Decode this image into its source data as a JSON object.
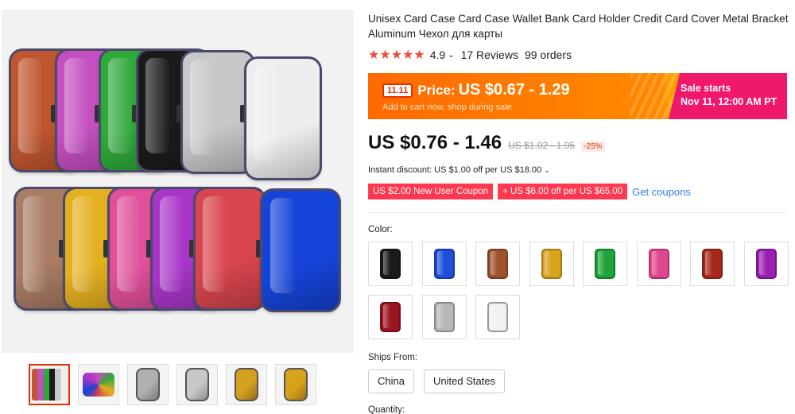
{
  "product": {
    "title": "Unisex Card Case Card Case Wallet Bank Card Holder Credit Card Cover Metal Bracket Aluminum Чехол для карты",
    "rating": "4.9",
    "reviews": "17 Reviews",
    "orders": "99 orders"
  },
  "promo": {
    "badge": "11.11",
    "price_label": "Price:",
    "price": "US $0.67 - 1.29",
    "subtitle": "Add to cart now, shop during sale",
    "sale_starts_label": "Sale starts",
    "sale_starts_date": "Nov 11, 12:00 AM PT"
  },
  "price": {
    "current": "US $0.76 - 1.46",
    "original": "US $1.02 - 1.95",
    "discount": "-25%"
  },
  "instant_discount": "Instant discount: US $1.00 off per US $18.00",
  "coupons": {
    "new_user": "US $2.00 New User Coupon",
    "store": "+ US $6.00 off per US $65.00",
    "get_link": "Get coupons"
  },
  "color": {
    "label": "Color:",
    "options": [
      "#1b1b1b",
      "#1d4fd8",
      "#a0522d",
      "#d9a21b",
      "#1fa33a",
      "#e0468c",
      "#a8281e",
      "#9b1fb0",
      "#9b1420",
      "#b7b7b7",
      "#f1f1f1"
    ]
  },
  "ships_from": {
    "label": "Ships From:",
    "options": [
      "China",
      "United States"
    ]
  },
  "quantity": {
    "label": "Quantity:"
  },
  "gallery": {
    "cards_top": [
      "#c0562f",
      "#c44fc0",
      "#2fa83a",
      "#1b1b1b",
      "#c8c8c8",
      "#eeeeee"
    ],
    "cards_bottom": [
      "#a97c64",
      "#e4b020",
      "#e0509a",
      "#a935c8",
      "#d9454e",
      "#1544d8"
    ],
    "thumbs": [
      "#e0509a",
      "#8aa",
      "#b0b0b0",
      "#c8c8c8",
      "#d4a020",
      "#d9a21b"
    ]
  },
  "icons": {
    "star": "star-icon",
    "chevron": "chevron-down-icon"
  }
}
